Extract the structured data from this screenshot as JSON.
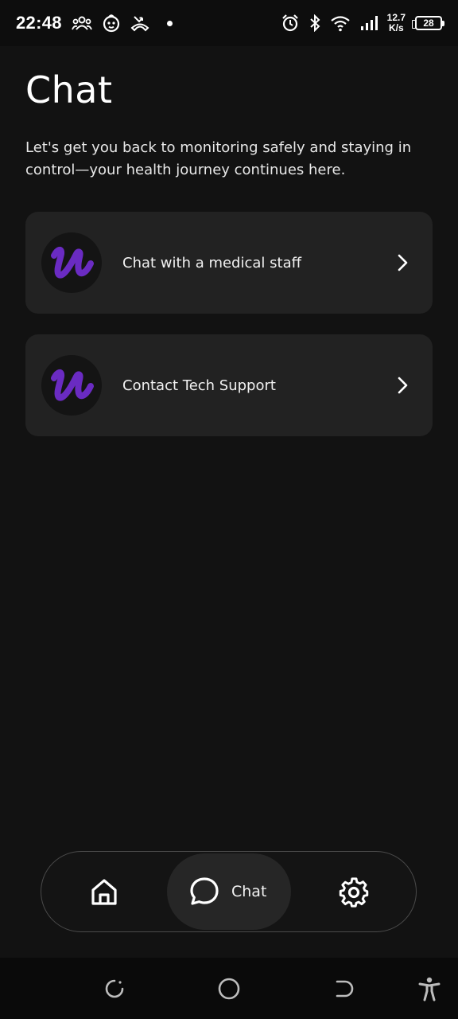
{
  "status_bar": {
    "time": "22:48",
    "net_speed_value": "12.7",
    "net_speed_unit": "K/s",
    "battery": "28",
    "icons": [
      "group-icon",
      "baby-face-icon",
      "missed-call-icon",
      "notification-dot",
      "alarm-icon",
      "bluetooth-icon",
      "wifi-icon",
      "signal-icon"
    ]
  },
  "header": {
    "title": "Chat",
    "subtitle": "Let's get you back to monitoring safely and staying in control—your health journey continues here."
  },
  "options": [
    {
      "label": "Chat with a medical staff",
      "icon": "u-logo-icon"
    },
    {
      "label": "Contact Tech Support",
      "icon": "u-logo-icon"
    }
  ],
  "bottom_nav": {
    "items": [
      {
        "icon": "home-icon",
        "label": ""
      },
      {
        "icon": "chat-bubble-icon",
        "label": "Chat",
        "active": true
      },
      {
        "icon": "gear-icon",
        "label": ""
      }
    ]
  },
  "colors": {
    "background": "#121212",
    "card": "#222222",
    "brand_purple": "#6a2bc2",
    "active_pill": "#262626"
  }
}
